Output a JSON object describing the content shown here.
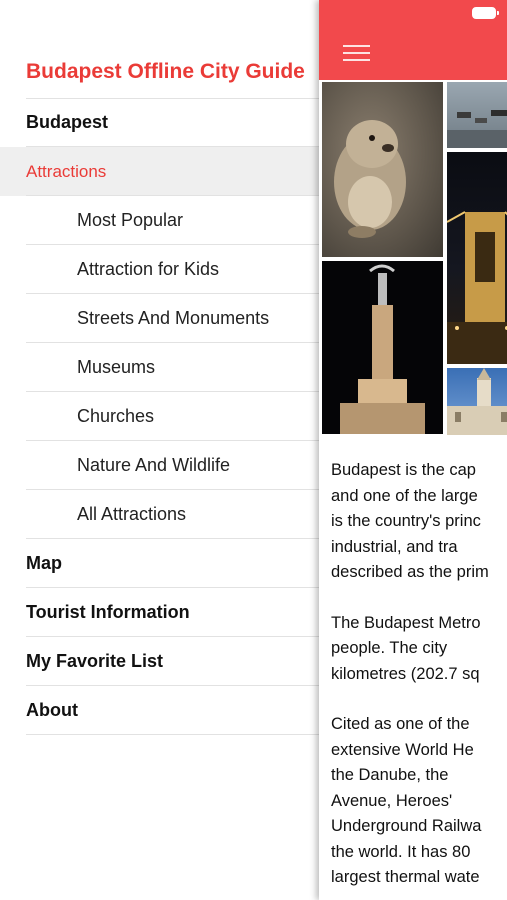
{
  "app_title": "Budapest Offline City Guide",
  "menu": {
    "items": [
      {
        "label": "Budapest",
        "level": "top",
        "selected": false
      },
      {
        "label": "Attractions",
        "level": "top",
        "selected": true
      },
      {
        "label": "Most Popular",
        "level": "sub",
        "selected": false
      },
      {
        "label": "Attraction for Kids",
        "level": "sub",
        "selected": false
      },
      {
        "label": "Streets And Monuments",
        "level": "sub",
        "selected": false
      },
      {
        "label": "Museums",
        "level": "sub",
        "selected": false
      },
      {
        "label": "Churches",
        "level": "sub",
        "selected": false
      },
      {
        "label": "Nature And Wildlife",
        "level": "sub",
        "selected": false
      },
      {
        "label": "All Attractions",
        "level": "sub",
        "selected": false
      },
      {
        "label": "Map",
        "level": "top",
        "selected": false
      },
      {
        "label": "Tourist Information",
        "level": "top",
        "selected": false
      },
      {
        "label": "My Favorite List",
        "level": "top",
        "selected": false
      },
      {
        "label": "About",
        "level": "top",
        "selected": false
      }
    ]
  },
  "content": {
    "navbar_icon": "hamburger-menu-icon",
    "status_icon": "battery-icon",
    "paragraphs": [
      "Budapest is the cap\nand one of the large\nis the country's princ\nindustrial, and tra\ndescribed as the prim",
      "The Budapest Metro\npeople. The city\nkilometres (202.7 sq",
      "Cited as one of the\nextensive World He\nthe Danube, the\nAvenue, Heroes'\nUnderground Railwa\nthe world. It has 80\nlargest thermal wate"
    ]
  },
  "colors": {
    "accent": "#ea3b37",
    "navbar": "#f2494c",
    "selected_row": "#efefef"
  }
}
